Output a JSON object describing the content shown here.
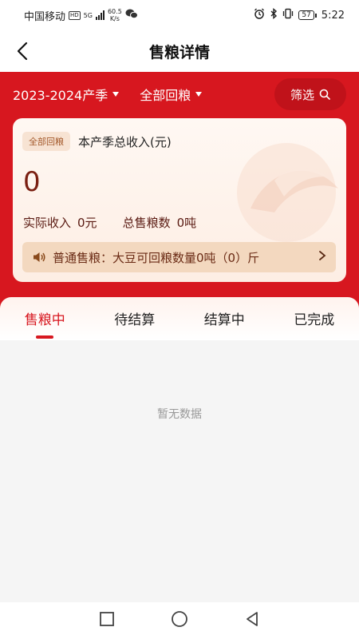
{
  "status_bar": {
    "carrier": "中国移动",
    "hd": "HD",
    "network": "5G",
    "speed_value": "60.5",
    "speed_unit": "K/s",
    "battery": "57",
    "time": "5:22"
  },
  "header": {
    "title": "售粮详情"
  },
  "filters": {
    "season": "2023-2024产季",
    "grain_type": "全部回粮",
    "filter_label": "筛选"
  },
  "summary": {
    "tag": "全部回粮",
    "title": "本产季总收入(元)",
    "total_income": "0",
    "actual_income_label": "实际收入",
    "actual_income_value": "0元",
    "total_sold_label": "总售粮数",
    "total_sold_value": "0吨",
    "notice": "普通售粮：大豆可回粮数量0吨（0）斤"
  },
  "tabs": [
    {
      "label": "售粮中",
      "active": true
    },
    {
      "label": "待结算",
      "active": false
    },
    {
      "label": "结算中",
      "active": false
    },
    {
      "label": "已完成",
      "active": false
    }
  ],
  "empty_state": "暂无数据",
  "colors": {
    "brand_red": "#d7171f",
    "income_text": "#7a1f12",
    "notice_bg": "#f3d8bf"
  },
  "icons": [
    "back-arrow-icon",
    "caret-down-icon",
    "search-icon",
    "speaker-icon",
    "chevron-right-icon",
    "square-icon",
    "circle-icon",
    "triangle-back-icon"
  ]
}
